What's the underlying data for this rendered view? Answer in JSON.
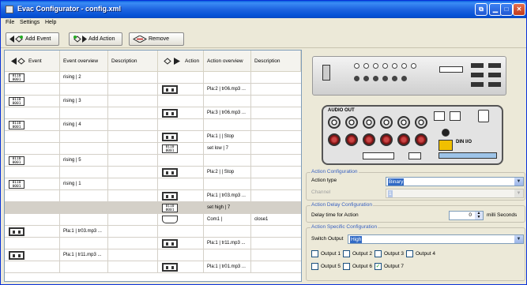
{
  "window": {
    "title": "Evac Configurator - config.xml"
  },
  "menu": [
    "File",
    "Settings",
    "Help"
  ],
  "toolbar": {
    "add_event": "Add Event",
    "add_action": "Add Action",
    "remove": "Remove"
  },
  "grid": {
    "columns": [
      "Event",
      "Event overview",
      "Description",
      "Action",
      "Action overview",
      "Description"
    ],
    "rows": [
      {
        "event_icon": "trigger",
        "event_overview": "rising | 2",
        "action_icon": "",
        "action_overview": "",
        "description": "",
        "selected": false
      },
      {
        "event_icon": "",
        "event_overview": "",
        "action_icon": "output",
        "action_overview": "Pla:2 | tr06.mp3 ...",
        "description": "",
        "selected": false
      },
      {
        "event_icon": "trigger",
        "event_overview": "rising | 3",
        "action_icon": "",
        "action_overview": "",
        "description": "",
        "selected": false
      },
      {
        "event_icon": "",
        "event_overview": "",
        "action_icon": "output",
        "action_overview": "Pla:3 | tr06.mp3 ...",
        "description": "",
        "selected": false
      },
      {
        "event_icon": "trigger",
        "event_overview": "rising | 4",
        "action_icon": "",
        "action_overview": "",
        "description": "",
        "selected": false
      },
      {
        "event_icon": "",
        "event_overview": "",
        "action_icon": "output",
        "action_overview": "Pla:1 |  | Stop",
        "description": "",
        "selected": false
      },
      {
        "event_icon": "",
        "event_overview": "",
        "action_icon": "trigger",
        "action_overview": "set low | 7",
        "description": "",
        "selected": false
      },
      {
        "event_icon": "trigger",
        "event_overview": "rising | 5",
        "action_icon": "",
        "action_overview": "",
        "description": "",
        "selected": false
      },
      {
        "event_icon": "",
        "event_overview": "",
        "action_icon": "output",
        "action_overview": "Pla:2 |  | Stop",
        "description": "",
        "selected": false
      },
      {
        "event_icon": "trigger",
        "event_overview": "rising | 1",
        "action_icon": "",
        "action_overview": "",
        "description": "",
        "selected": false
      },
      {
        "event_icon": "",
        "event_overview": "",
        "action_icon": "output",
        "action_overview": "Pla:1 | tr03.mp3 ...",
        "description": "",
        "selected": false
      },
      {
        "event_icon": "",
        "event_overview": "",
        "action_icon": "trigger",
        "action_overview": "set high | 7",
        "description": "",
        "selected": true
      },
      {
        "event_icon": "",
        "event_overview": "",
        "action_icon": "com",
        "action_overview": "Com1 | ",
        "description": "close1",
        "selected": false
      },
      {
        "event_icon": "output",
        "event_overview": "Pla:1 | tr03.mp3 ...",
        "action_icon": "",
        "action_overview": "",
        "description": "",
        "selected": false
      },
      {
        "event_icon": "",
        "event_overview": "",
        "action_icon": "output",
        "action_overview": "Pla:1 | tr11.mp3 ...",
        "description": "",
        "selected": false
      },
      {
        "event_icon": "output",
        "event_overview": "Pla:1 | tr11.mp3 ...",
        "action_icon": "",
        "action_overview": "",
        "description": "",
        "selected": false
      },
      {
        "event_icon": "",
        "event_overview": "",
        "action_icon": "output",
        "action_overview": "Pla:1 | tr01.mp3 ...",
        "description": "",
        "selected": false
      }
    ]
  },
  "device": {
    "audio_out_label": "AUDIO OUT",
    "din_label": "DIN I/O"
  },
  "action_config": {
    "legend": "Action Configuration",
    "type_label": "Action type",
    "type_value": "Binary",
    "channel_label": "Channel",
    "channel_value": "1"
  },
  "delay_config": {
    "legend": "Action Delay Configuration",
    "label": "Delay time for Action",
    "value": "0",
    "unit": "milli Seconds"
  },
  "specific_config": {
    "legend": "Action Specific Configuration",
    "switch_label": "Switch Output",
    "switch_value": "High",
    "outputs": [
      {
        "label": "Output 1",
        "checked": false
      },
      {
        "label": "Output 2",
        "checked": false
      },
      {
        "label": "Output 3",
        "checked": false
      },
      {
        "label": "Output 4",
        "checked": false
      },
      {
        "label": "Output 5",
        "checked": false
      },
      {
        "label": "Output 6",
        "checked": false
      },
      {
        "label": "Output 7",
        "checked": true
      }
    ]
  },
  "trigger_icon_text": "0110|0001"
}
